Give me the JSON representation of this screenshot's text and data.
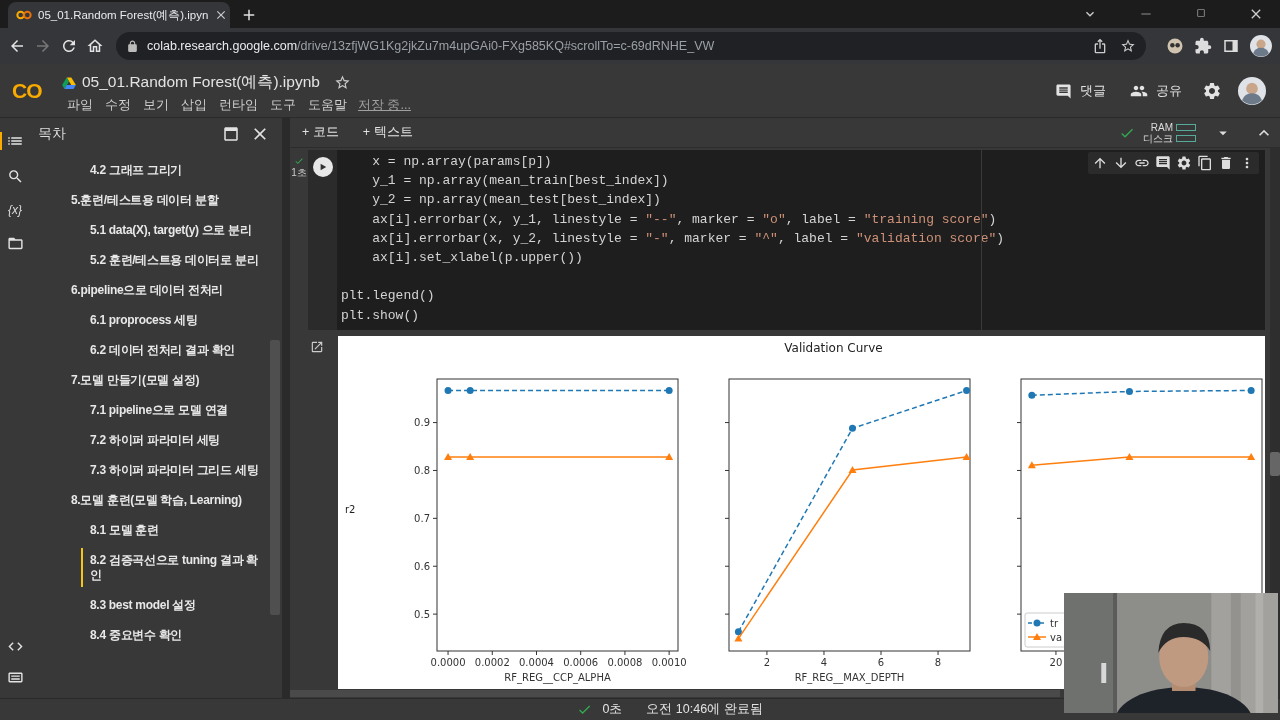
{
  "browser": {
    "tab": {
      "title": "05_01.Random Forest(예측).ipyn",
      "selected": true
    },
    "url_host": "colab.research.google.com",
    "url_path": "/drive/13zfjWG1Kg2jkZu7m4upGAi0-FXg585KQ#scrollTo=c-69dRNHE_VW"
  },
  "colab": {
    "logo": "CO",
    "title": "05_01.Random Forest(예측).ipynb",
    "menu": [
      "파일",
      "수정",
      "보기",
      "삽입",
      "런타임",
      "도구",
      "도움말"
    ],
    "save_status": "저장 중...",
    "comment": "댓글",
    "share": "공유"
  },
  "rail": {
    "variables": "{x}"
  },
  "toc": {
    "title": "목차",
    "items": [
      {
        "children": [
          {
            "label": "4.2 그래프 그리기",
            "selected": false
          }
        ]
      },
      {
        "label": "5.훈련/테스트용 데이터 분할",
        "selected": false,
        "children": [
          {
            "label": "5.1 data(X), target(y) 으로 분리",
            "selected": false
          },
          {
            "label": "5.2 훈련/테스트용 데이터로 분리",
            "selected": false
          }
        ]
      },
      {
        "label": "6.pipeline으로 데이터 전처리",
        "selected": false,
        "children": [
          {
            "label": "6.1 proprocess 세팅",
            "selected": false
          },
          {
            "label": "6.2 데이터 전처리 결과 확인",
            "selected": false
          }
        ]
      },
      {
        "label": "7.모델 만들기(모델 설정)",
        "selected": false,
        "children": [
          {
            "label": "7.1 pipeline으로 모델 연결",
            "selected": false
          },
          {
            "label": "7.2 하이퍼 파라미터 세팅",
            "selected": false
          },
          {
            "label": "7.3 하이퍼 파라미터 그리드 세팅",
            "selected": false
          }
        ]
      },
      {
        "label": "8.모델 훈련(모델 학습, Learning)",
        "selected": false,
        "children": [
          {
            "label": "8.1 모델 훈련",
            "selected": false
          },
          {
            "label": "8.2 검증곡선으로 tuning 결과 확인",
            "selected": true
          },
          {
            "label": "8.3 best model 설정",
            "selected": false
          },
          {
            "label": "8.4 중요변수 확인",
            "selected": false
          }
        ]
      }
    ]
  },
  "toolbar": {
    "add_code": "+ 코드",
    "add_text": "+ 텍스트",
    "ram": "RAM",
    "disk": "디스크"
  },
  "cell": {
    "exec_time": "1초",
    "blocks": [
      [
        "    x = np.array(params[p])",
        "    y_1 = np.array(mean_train[best_index])",
        "    y_2 = np.array(mean_test[best_index])",
        "    ax[i].errorbar(x, y_1, linestyle = \"--\", marker = \"o\", label = \"training score\")",
        "    ax[i].errorbar(x, y_2, linestyle = \"-\", marker = \"^\", label = \"validation score\")",
        "    ax[i].set_xlabel(p.upper())"
      ],
      [
        "plt.legend()",
        "plt.show()"
      ]
    ]
  },
  "figure": {
    "title": "Validation Curve",
    "ylabel": "r2",
    "subplots": [
      {
        "chart_data": {
          "type": "line",
          "xlabel": "RF_REG__CCP_ALPHA",
          "x": [
            0,
            0.0001,
            0.001
          ],
          "xlim": [
            -5e-05,
            0.00104
          ],
          "ylim": [
            0.423,
            0.991
          ],
          "xticks": [
            {
              "value": 0,
              "label": "0.0000"
            },
            {
              "value": 0.0002,
              "label": "0.0002"
            },
            {
              "value": 0.0004,
              "label": "0.0004"
            },
            {
              "value": 0.0006,
              "label": "0.0006"
            },
            {
              "value": 0.0008,
              "label": "0.0008"
            },
            {
              "value": 0.001,
              "label": "0.0010"
            }
          ],
          "yticks": [
            0.5,
            0.6,
            0.7,
            0.8,
            0.9
          ],
          "series": [
            {
              "color": "#1f77b4",
              "line_style": "dashed",
              "marker": "circle",
              "values": [
                0.967,
                0.967,
                0.967
              ]
            },
            {
              "color": "#ff7f0e",
              "line_style": "solid",
              "marker": "triangle",
              "values": [
                0.828,
                0.828,
                0.828
              ]
            }
          ]
        }
      },
      {
        "chart_data": {
          "type": "line",
          "xlabel": "RF_REG__MAX_DEPTH",
          "x": [
            1,
            5,
            9
          ],
          "xlim": [
            0.67,
            9.12
          ],
          "ylim": [
            0.423,
            0.991
          ],
          "xticks": [
            2,
            4,
            6,
            8
          ],
          "series": [
            {
              "color": "#1f77b4",
              "line_style": "dashed",
              "marker": "circle",
              "values": [
                0.463,
                0.888,
                0.967
              ]
            },
            {
              "color": "#ff7f0e",
              "line_style": "solid",
              "marker": "triangle",
              "values": [
                0.449,
                0.801,
                0.828
              ]
            }
          ]
        }
      },
      {
        "kind": "plot",
        "tick_label": "20",
        "legend": [
          {
            "label": "tr",
            "color": "#1f77b4"
          },
          {
            "label": "va",
            "color": "#ff7f0e"
          }
        ]
      }
    ]
  },
  "status": {
    "time": "0초",
    "message": "오전 10:46에 완료됨"
  }
}
